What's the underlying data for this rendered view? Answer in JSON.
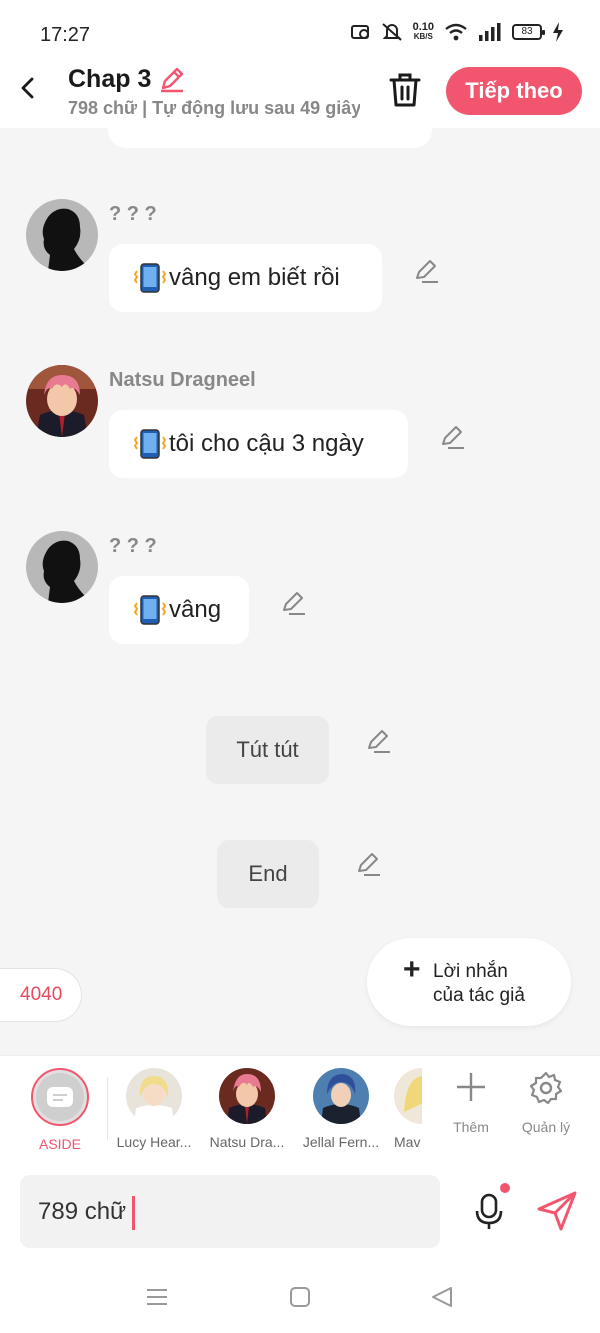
{
  "status_bar": {
    "time": "17:27",
    "net_speed": "0.10",
    "net_unit": "KB/S",
    "battery": "83"
  },
  "header": {
    "title": "Chap 3",
    "subtitle": "798 chữ | Tự động lưu sau 49 giây",
    "next_label": "Tiếp theo"
  },
  "messages": [
    {
      "speaker": "? ? ?",
      "text": "vâng em biết rồi",
      "has_phone_icon": true
    },
    {
      "speaker": "Natsu Dragneel",
      "text": "tôi cho cậu 3 ngày",
      "has_phone_icon": true
    },
    {
      "speaker": "? ? ?",
      "text": "vâng",
      "has_phone_icon": true
    }
  ],
  "system_messages": [
    {
      "text": "Tút tút"
    },
    {
      "text": "End"
    }
  ],
  "word_count_pill": "4040",
  "author_note": {
    "label": "Lời nhắn của tác giả"
  },
  "characters": [
    {
      "name": "ASIDE",
      "active": true
    },
    {
      "name": "Lucy Hear..."
    },
    {
      "name": "Natsu Dra..."
    },
    {
      "name": "Jellal Fern..."
    },
    {
      "name": "Mav"
    }
  ],
  "tools": {
    "add_label": "Thêm",
    "manage_label": "Quản lý"
  },
  "composer": {
    "value": "789 chữ"
  },
  "colors": {
    "accent": "#f2566f",
    "background": "#f5f5f5",
    "bubble": "#ffffff"
  }
}
